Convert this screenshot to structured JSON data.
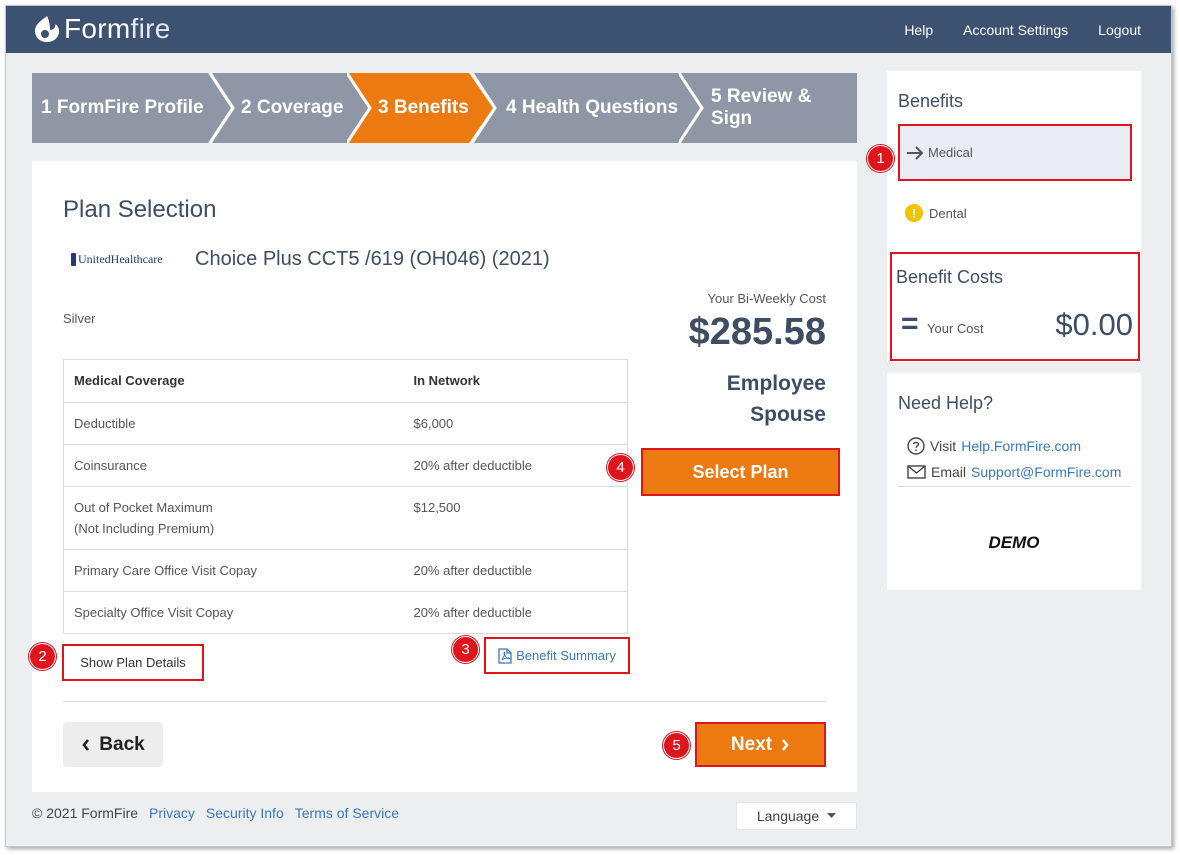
{
  "topbar": {
    "brand_a": "Form",
    "brand_b": "fire",
    "nav": [
      "Help",
      "Account Settings",
      "Logout"
    ]
  },
  "steps": [
    {
      "label": "1  FormFire Profile",
      "state": "done"
    },
    {
      "label": "2  Coverage",
      "state": "done"
    },
    {
      "label": "3  Benefits",
      "state": "active"
    },
    {
      "label": "4  Health Questions",
      "state": "todo"
    },
    {
      "label": "5  Review & Sign",
      "state": "todo"
    }
  ],
  "plan": {
    "heading": "Plan Selection",
    "carrier_logo_text": "UnitedHealthcare",
    "name": "Choice Plus CCT5 /619 (OH046) (2021)",
    "tier": "Silver",
    "cost_label": "Your Bi-Weekly Cost",
    "cost": "$285.58",
    "coverage_line1": "Employee",
    "coverage_line2": "Spouse",
    "table": {
      "headers": [
        "Medical Coverage",
        "In Network"
      ],
      "rows": [
        [
          "Deductible",
          "$6,000"
        ],
        [
          "Coinsurance",
          "20% after deductible"
        ],
        [
          "Out of Pocket Maximum",
          "$12,500"
        ],
        [
          "Primary Care Office Visit Copay",
          "20% after deductible"
        ],
        [
          "Specialty Office Visit Copay",
          "20% after deductible"
        ]
      ],
      "oop_note": "(Not Including Premium)"
    },
    "show_details": "Show Plan Details",
    "benefit_summary": "Benefit Summary",
    "select_plan": "Select Plan",
    "back": "Back",
    "next": "Next"
  },
  "footer": {
    "copyright": "© 2021 FormFire",
    "links": [
      "Privacy",
      "Security Info",
      "Terms of Service"
    ],
    "language": "Language"
  },
  "sidebar": {
    "benefits_heading": "Benefits",
    "medical": "Medical",
    "dental": "Dental",
    "costs_heading": "Benefit Costs",
    "eq_symbol": "=",
    "your_cost_label": "Your Cost",
    "your_cost": "$0.00",
    "help_heading": "Need Help?",
    "visit_label": "Visit",
    "visit_link": "Help.FormFire.com",
    "email_label": "Email",
    "email_link": "Support@FormFire.com",
    "demo": "DEMO"
  },
  "badges": [
    "1",
    "2",
    "3",
    "4",
    "5"
  ],
  "colors": {
    "topbar": "#3d5170",
    "step_done": "#8f97a6",
    "step_active": "#ec7a10",
    "annotation": "#e0141c",
    "link": "#3a78c2"
  }
}
